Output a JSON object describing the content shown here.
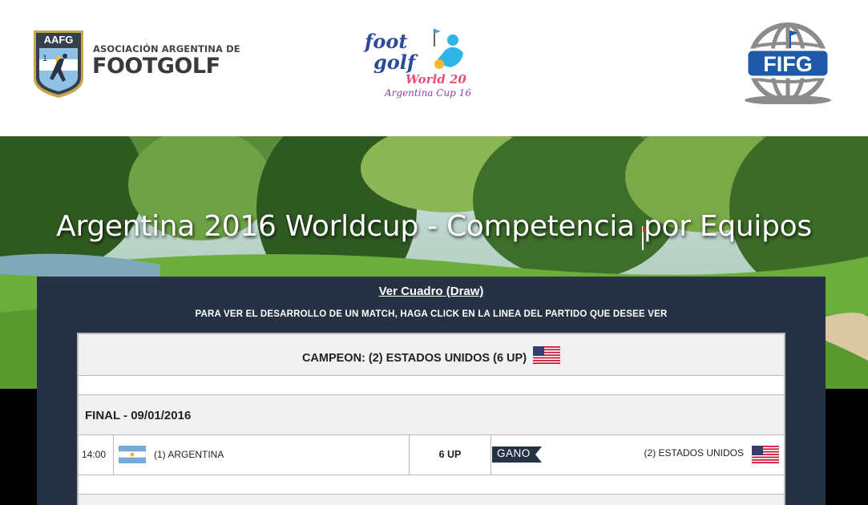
{
  "header": {
    "aafg": {
      "badge": "AAFG",
      "line1": "ASOCIACIÓN ARGENTINA DE",
      "line2": "FOOTGOLF"
    },
    "footgolf_logo": {
      "line1": "foot",
      "line2": "golf",
      "line3": "World 20",
      "line4": "Argentina Cup 16"
    },
    "fifg_logo": {
      "text": "FIFG"
    }
  },
  "banner": {
    "title": "Argentina 2016 Worldcup - Competencia por Equipos"
  },
  "panel": {
    "draw_link": "Ver Cuadro (Draw)",
    "instructions": "PARA VER EL DESARROLLO DE UN MATCH, HAGA CLICK EN LA LINEA DEL PARTIDO QUE DESEE VER",
    "champion": "CAMPEON: (2) ESTADOS UNIDOS (6 UP)",
    "round": "FINAL - 09/01/2016",
    "match": {
      "time": "14:00",
      "home": "(1) ARGENTINA",
      "score": "6 UP",
      "result_badge": "GANO",
      "away": "(2) ESTADOS UNIDOS"
    }
  },
  "colors": {
    "panel_bg": "#243243",
    "badge_bg": "#243243"
  }
}
